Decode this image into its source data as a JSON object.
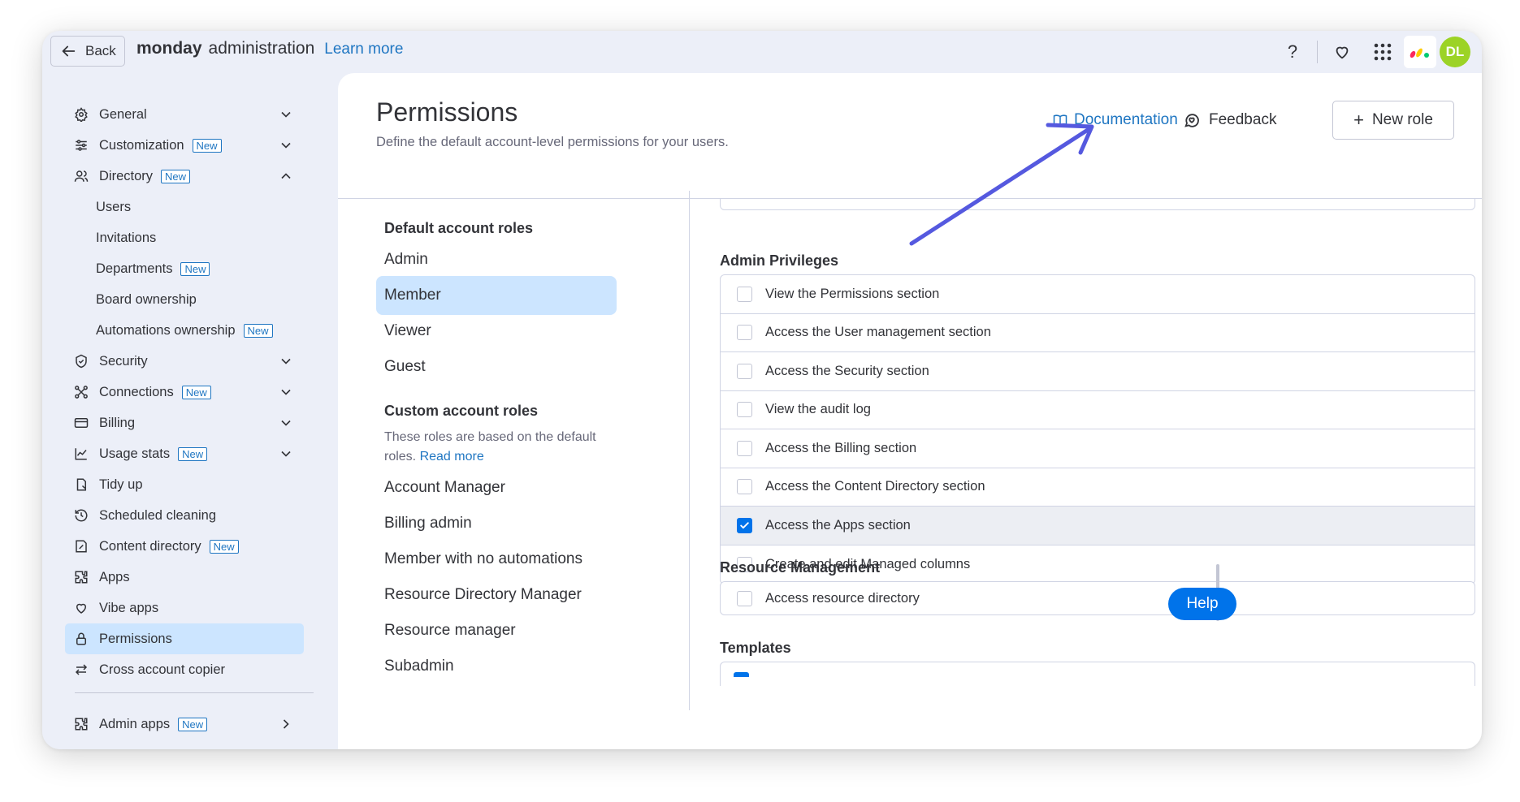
{
  "topbar": {
    "back_label": "Back",
    "brand_bold": "monday",
    "brand_rest": "administration",
    "learn_more": "Learn more",
    "avatar_initials": "DL"
  },
  "sidebar": {
    "new_badge": "New",
    "items": [
      {
        "label": "General",
        "icon": "gear-icon",
        "badge": false,
        "chevron": "down"
      },
      {
        "label": "Customization",
        "icon": "sliders-icon",
        "badge": true,
        "chevron": "down"
      },
      {
        "label": "Directory",
        "icon": "people-icon",
        "badge": true,
        "chevron": "up"
      },
      {
        "label": "Users",
        "sub": true
      },
      {
        "label": "Invitations",
        "sub": true
      },
      {
        "label": "Departments",
        "sub": true,
        "badge": true
      },
      {
        "label": "Board ownership",
        "sub": true
      },
      {
        "label": "Automations ownership",
        "sub": true,
        "badge": true
      },
      {
        "label": "Security",
        "icon": "shield-icon",
        "chevron": "down"
      },
      {
        "label": "Connections",
        "icon": "connections-icon",
        "badge": true,
        "chevron": "down"
      },
      {
        "label": "Billing",
        "icon": "card-icon",
        "chevron": "down"
      },
      {
        "label": "Usage stats",
        "icon": "chart-icon",
        "badge": true,
        "chevron": "down"
      },
      {
        "label": "Tidy up",
        "icon": "tidy-icon"
      },
      {
        "label": "Scheduled cleaning",
        "icon": "history-icon"
      },
      {
        "label": "Content directory",
        "icon": "content-icon",
        "badge": true
      },
      {
        "label": "Apps",
        "icon": "puzzle-icon"
      },
      {
        "label": "Vibe apps",
        "icon": "heart-icon"
      },
      {
        "label": "Permissions",
        "icon": "lock-icon",
        "active": true
      },
      {
        "label": "Cross account copier",
        "icon": "swap-icon"
      },
      {
        "label": "Admin apps",
        "icon": "puzzle-icon",
        "badge": true,
        "chevron": "right"
      }
    ]
  },
  "header": {
    "title": "Permissions",
    "subtitle": "Define the default account-level permissions for your users.",
    "documentation": "Documentation",
    "feedback": "Feedback",
    "new_role": "New role"
  },
  "roles": {
    "default_heading": "Default account roles",
    "default": [
      "Admin",
      "Member",
      "Viewer",
      "Guest"
    ],
    "selected": "Member",
    "custom_heading": "Custom account roles",
    "custom_desc": "These roles are based on the default roles.",
    "read_more": "Read more",
    "custom": [
      "Account Manager",
      "Billing admin",
      "Member with no automations",
      "Resource Directory Manager",
      "Resource manager",
      "Subadmin"
    ]
  },
  "permissions": {
    "admin_title": "Admin Privileges",
    "admin_items": [
      {
        "label": "View the Permissions section",
        "checked": false
      },
      {
        "label": "Access the User management section",
        "checked": false
      },
      {
        "label": "Access the Security section",
        "checked": false
      },
      {
        "label": "View the audit log",
        "checked": false
      },
      {
        "label": "Access the Billing section",
        "checked": false
      },
      {
        "label": "Access the Content Directory section",
        "checked": false
      },
      {
        "label": "Access the Apps section",
        "checked": true
      },
      {
        "label": "Create and edit Managed columns",
        "checked": false
      }
    ],
    "resource_title": "Resource Management",
    "resource_items": [
      {
        "label": "Access resource directory",
        "checked": false
      }
    ],
    "templates_title": "Templates"
  },
  "help": "Help",
  "colors": {
    "accent": "#0073ea",
    "link": "#1f76c2",
    "selected_bg": "#cce5ff",
    "arrow": "#5559df"
  }
}
